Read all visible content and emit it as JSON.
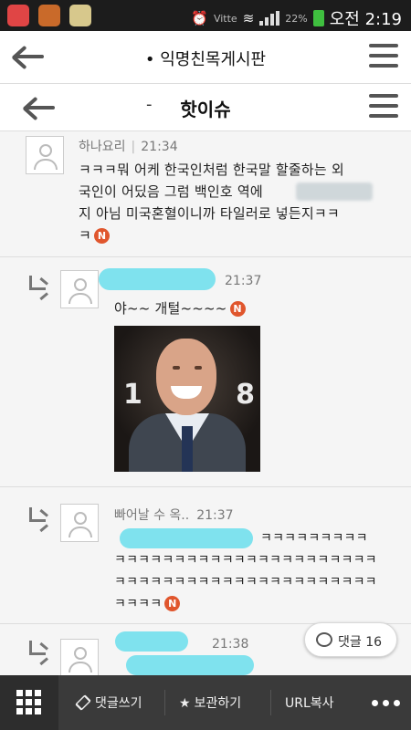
{
  "status_bar": {
    "network_label": "Vitte",
    "battery": "22%",
    "time": "오전 2:19"
  },
  "header": {
    "title": "• 익명친목게시판"
  },
  "board_header": {
    "dash": "-",
    "title": "핫이슈"
  },
  "comments": [
    {
      "author": "하나요리",
      "time": "21:34",
      "lines": [
        "ㅋㅋㅋ뭐 어케 한국인처럼 한국말 할줄하는 외",
        "국인이 어딨음 그럼 백인호 역에",
        "지 아님 미국혼혈이니까 타일러로 넣든지ㅋㅋ",
        "ㅋ"
      ],
      "new_badge": "N"
    },
    {
      "author": "",
      "time": "21:37",
      "text": "야~~ 개털~~~~",
      "new_badge": "N",
      "is_reply": true
    },
    {
      "author": "빠어날 수 옥..",
      "time": "21:37",
      "lines": [
        "ㅋㅋㅋㅋㅋㅋㅋㅋㅋ",
        "ㅋㅋㅋㅋㅋㅋㅋㅋㅋㅋㅋㅋㅋㅋㅋㅋㅋㅋㅋㅋㅋㅋ",
        "ㅋㅋㅋㅋㅋㅋㅋㅋㅋㅋㅋㅋㅋㅋㅋㅋㅋㅋㅋㅋㅋㅋ",
        "ㅋㅋㅋㅋ"
      ],
      "new_badge": "N",
      "is_reply": true
    },
    {
      "author": "",
      "time": "21:38",
      "is_reply": true
    }
  ],
  "photo": {
    "number_left": "1",
    "number_right": "8"
  },
  "comment_count": {
    "label": "댓글 16"
  },
  "bottom_bar": {
    "write_comment": "댓글쓰기",
    "bookmark": "보관하기",
    "copy_url": "URL복사"
  }
}
